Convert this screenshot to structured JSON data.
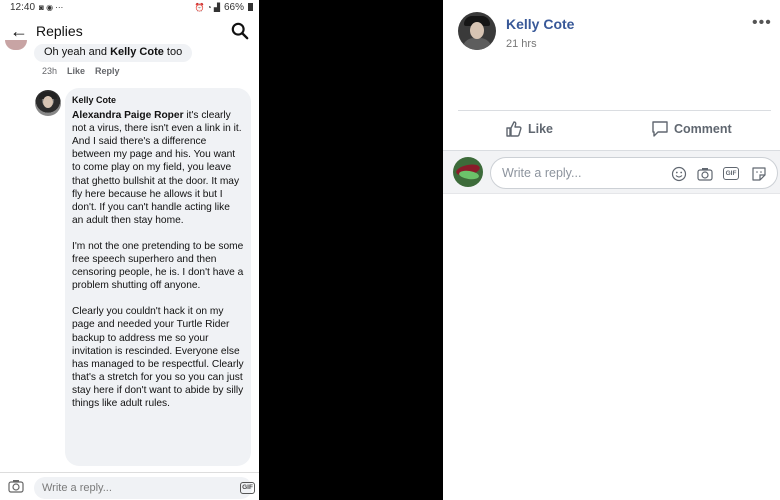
{
  "left": {
    "status": {
      "time": "12:40",
      "battery": "66%"
    },
    "topbar": {
      "title": "Replies"
    },
    "prev_reply": {
      "text_before": "Oh yeah and ",
      "mention": "Kelly Cote",
      "text_after": " too",
      "time": "23h",
      "like": "Like",
      "reply": "Reply"
    },
    "comment": {
      "author": "Kelly Cote",
      "mention": "Alexandra Paige Roper",
      "p1": " it's clearly not a virus, there isn't even a link in it. And I said there's a difference between my page and his. You want to come play on my field, you leave that ghetto bullshit at the door. It may fly here because he allows it but I don't. If you can't handle acting like an adult then stay home.",
      "p2": "I'm not the one pretending to be some free speech superhero and then censoring people,  he is. I don't have a problem shutting off anyone.",
      "p3": "Clearly you couldn't hack it on my page and needed your Turtle Rider backup to address me so your invitation is rescinded.  Everyone else has managed to be respectful. Clearly that's a stretch for you so you can just stay here if don't want to abide by silly things like adult rules."
    },
    "composer": {
      "placeholder": "Write a reply...",
      "gif": "GIF"
    }
  },
  "right": {
    "name": "Kelly Cote",
    "time": "21 hrs",
    "more": "•••",
    "like": "Like",
    "comment": "Comment",
    "composer": {
      "placeholder": "Write a reply...",
      "gif": "GIF"
    }
  },
  "colors": {
    "link": "#385898",
    "bubble": "#f0f2f5",
    "meta": "#65676b"
  }
}
